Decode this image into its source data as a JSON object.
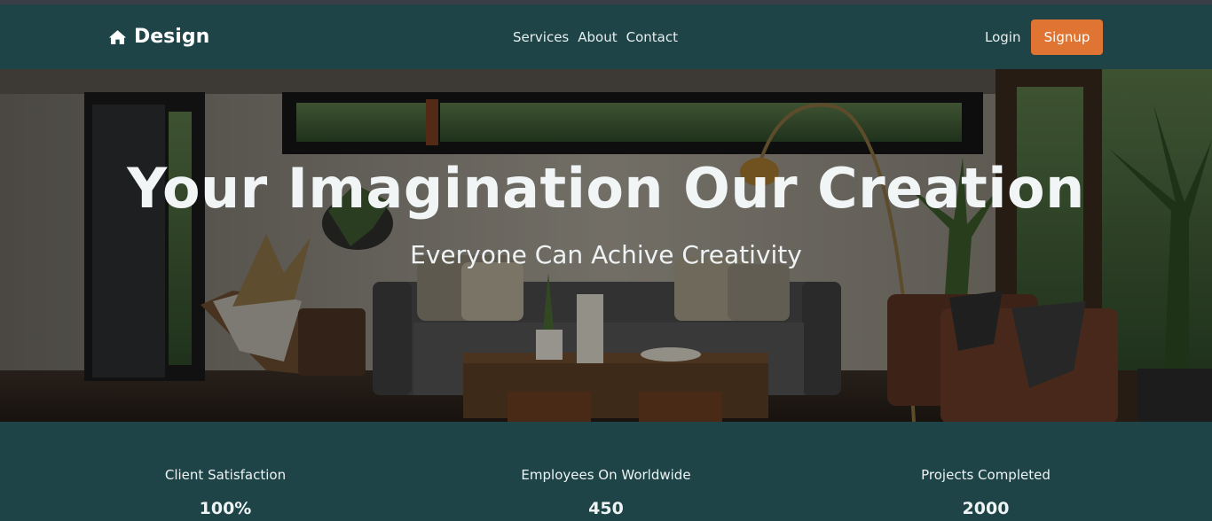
{
  "brand": {
    "name": "Design",
    "icon": "home-icon"
  },
  "nav": {
    "links": [
      "Services",
      "About",
      "Contact"
    ],
    "login": "Login",
    "signup": "Signup"
  },
  "hero": {
    "title": "Your Imagination Our Creation",
    "subtitle": "Everyone Can Achive Creativity"
  },
  "stats": [
    {
      "label": "Client Satisfaction",
      "value": "100%"
    },
    {
      "label": "Employees On Worldwide",
      "value": "450"
    },
    {
      "label": "Projects Completed",
      "value": "2000"
    }
  ],
  "colors": {
    "nav_bg": "#1e4448",
    "accent": "#e07432",
    "text": "#ffffff"
  }
}
